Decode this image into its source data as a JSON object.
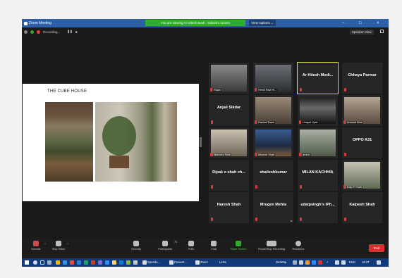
{
  "window": {
    "title": "Zoom Meeting",
    "share_banner": "You are viewing Ar Hitesh Modi - Sabalo's screen",
    "view_options": "View Options ⌄",
    "minimize": "–",
    "maximize": "□",
    "close": "×"
  },
  "top": {
    "recording_label": "Recording...",
    "pause_glyph": "❚❚",
    "stop_glyph": "■",
    "speaker_view": "Speaker View"
  },
  "slide": {
    "title": "THE CUBE HOUSE"
  },
  "participants": [
    {
      "name": "Rajan",
      "caption": "Rajan",
      "video": true
    },
    {
      "name": "Hemil Ravi Hi...",
      "caption": "Hemil Ravi Hi...",
      "video": true
    },
    {
      "name": "Ar Hitesh Modi...",
      "caption": "",
      "video": false,
      "active": true
    },
    {
      "name": "Chhaya Parmar",
      "caption": "",
      "video": false
    },
    {
      "name": "Anjali Sikdar",
      "caption": "",
      "video": false
    },
    {
      "name": "Rashmi Dave",
      "caption": "Rashmi Dave",
      "video": true
    },
    {
      "name": "Unapal Vyas",
      "caption": "Unapal Vyas",
      "video": true
    },
    {
      "name": "Android Bhai",
      "caption": "Android Bhai",
      "video": true
    },
    {
      "name": "Manisha Shah",
      "caption": "Manisha Shah",
      "video": true
    },
    {
      "name": "Mukesh Shah",
      "caption": "Mukesh Shah",
      "video": true
    },
    {
      "name": "anand",
      "caption": "anand",
      "video": true
    },
    {
      "name": "OPPO A31",
      "caption": "",
      "video": false
    },
    {
      "name": "Dipak o shah ch...",
      "caption": "",
      "video": false
    },
    {
      "name": "shaileshkumar",
      "caption": "",
      "video": false
    },
    {
      "name": "MILAN KACHHIA",
      "caption": "",
      "video": false
    },
    {
      "name": "Kalp P Shah",
      "caption": "Kalp P Shah",
      "video": true
    },
    {
      "name": "Haresh Shah",
      "caption": "",
      "video": false
    },
    {
      "name": "Mrugen Mehta",
      "caption": "",
      "video": false
    },
    {
      "name": "udaipsingh's iPh...",
      "caption": "",
      "video": false
    },
    {
      "name": "Kalpesh Shah",
      "caption": "",
      "video": false
    }
  ],
  "toolbar": {
    "unmute": "Unmute",
    "stop_video": "Stop Video",
    "security": "Security",
    "participants": "Participants",
    "participants_count": "70",
    "polls": "Polls",
    "chat": "Chat",
    "share_screen": "Share Screen",
    "pause_recording": "Pause/Stop Recording",
    "reactions": "Reactions",
    "end": "End"
  },
  "taskbar": {
    "app1": "Speedo...",
    "app2": "Present...",
    "app3": "Zoom",
    "links": "Links",
    "desktop": "Desktop",
    "lang": "ENG",
    "time": "18:37"
  },
  "colors": {
    "titlebar": "#2d5fa8",
    "banner": "#2ead2e",
    "end_button": "#d93030",
    "active_speaker": "#d9e04a",
    "taskbar": "#123a78"
  }
}
